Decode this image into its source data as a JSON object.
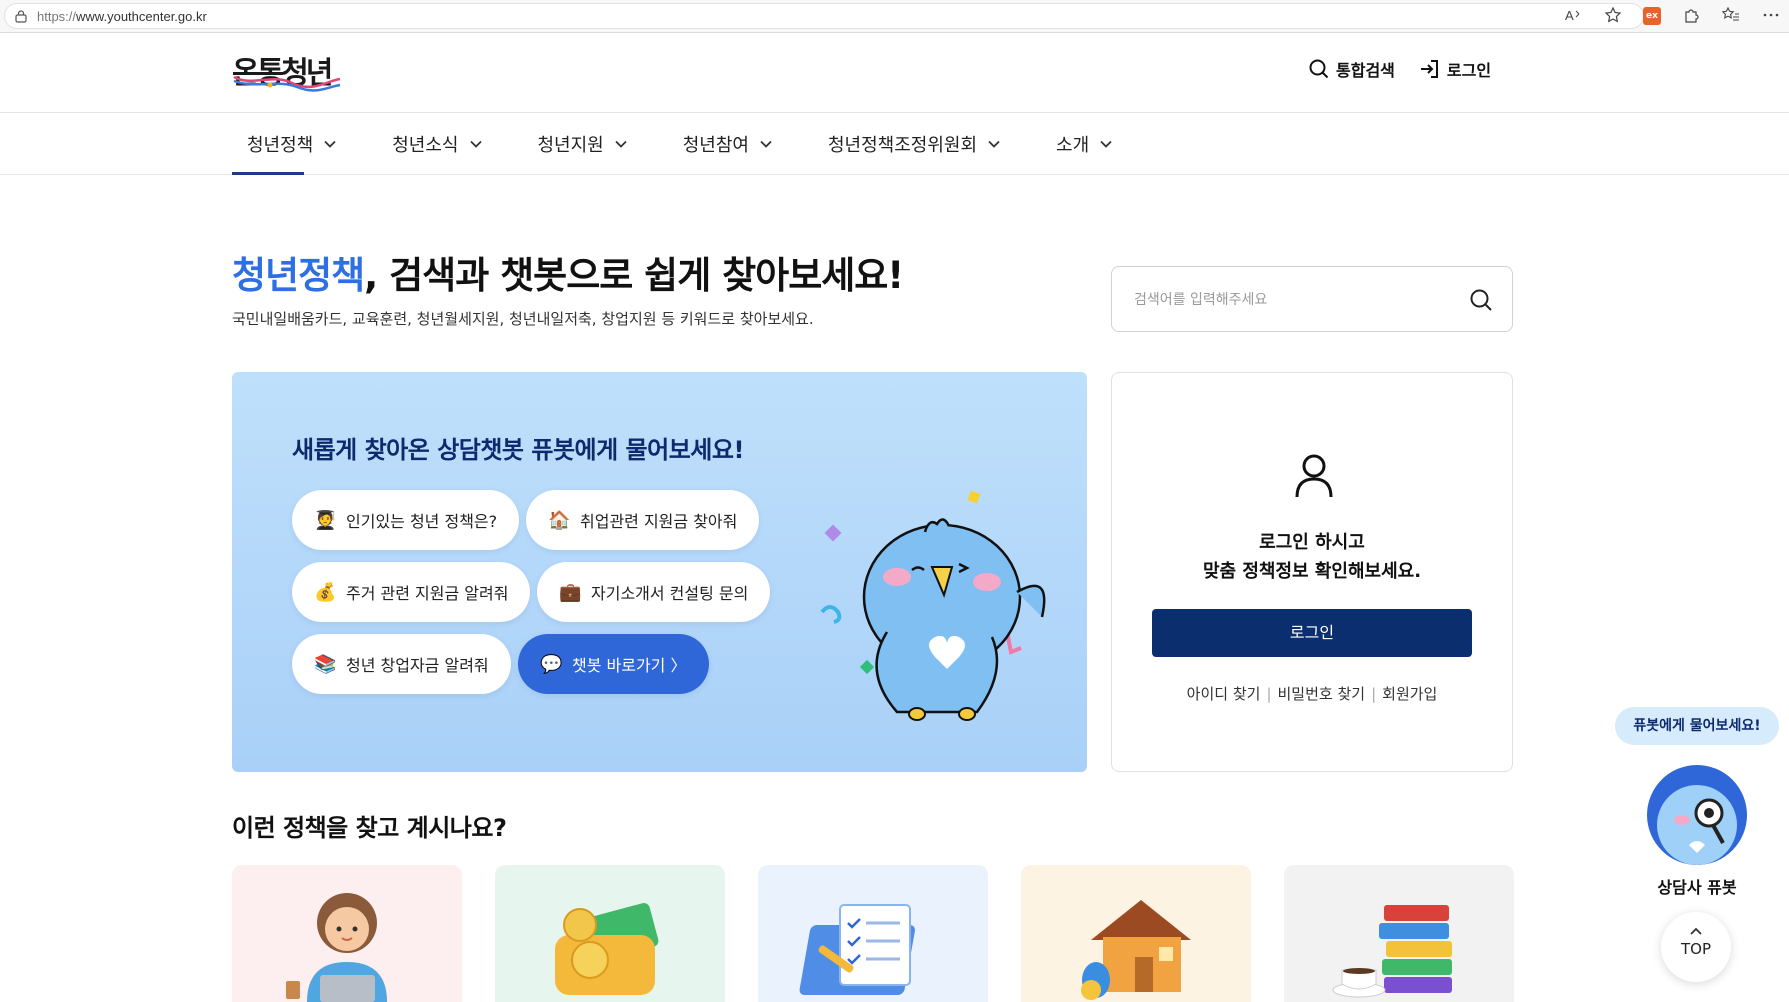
{
  "browser": {
    "url_protocol": "https://",
    "url_host": "www.youthcenter.go.kr",
    "extension_badge": "ex"
  },
  "header": {
    "logo_text": "온통청년",
    "search_label": "통합검색",
    "login_label": "로그인"
  },
  "nav": {
    "items": [
      {
        "label": "청년정책"
      },
      {
        "label": "청년소식"
      },
      {
        "label": "청년지원"
      },
      {
        "label": "청년참여"
      },
      {
        "label": "청년정책조정위원회"
      },
      {
        "label": "소개"
      }
    ]
  },
  "hero": {
    "title_accent": "청년정책",
    "title_rest": ", 검색과 챗봇으로 쉽게 찾아보세요!",
    "subtitle": "국민내일배움카드, 교육훈련, 청년월세지원, 청년내일저축, 창업지원 등 키워드로 찾아보세요.",
    "search_placeholder": "검색어를 입력해주세요"
  },
  "chat": {
    "heading_prefix": "새롭게 찾아온 상담챗봇 ",
    "heading_bold": "퓨봇",
    "heading_suffix": "에게 물어보세요!",
    "chips": [
      {
        "emoji": "🧑‍🎓",
        "label": "인기있는 청년 정책은?"
      },
      {
        "emoji": "🏠",
        "label": "취업관련 지원금 찾아줘"
      },
      {
        "emoji": "💰",
        "label": "주거 관련 지원금 알려줘"
      },
      {
        "emoji": "💼",
        "label": "자기소개서 컨설팅 문의"
      },
      {
        "emoji": "📚",
        "label": "청년 창업자금 알려줘"
      },
      {
        "emoji": "💬",
        "label": "챗봇 바로가기 〉"
      }
    ]
  },
  "login_panel": {
    "message_line1": "로그인 하시고",
    "message_line2": "맞춤 정책정보 확인해보세요.",
    "button": "로그인",
    "find_id": "아이디 찾기",
    "find_pw": "비밀번호 찾기",
    "signup": "회원가입",
    "separator": "|"
  },
  "section": {
    "title": "이런 정책을 찾고 계시나요?",
    "cards": [
      {
        "bg": "#fdeef0"
      },
      {
        "bg": "#e6f6ee"
      },
      {
        "bg": "#eaf2fd"
      },
      {
        "bg": "#fdf3e3"
      },
      {
        "bg": "#f2f2f2"
      }
    ]
  },
  "floating": {
    "bubble": "퓨봇에게 물어보세요!",
    "label": "상담사 퓨봇",
    "top": "TOP"
  },
  "colors": {
    "accent": "#2f6fe4",
    "navy": "#0b2f6e",
    "chat_bg": "#b5d8fa"
  }
}
